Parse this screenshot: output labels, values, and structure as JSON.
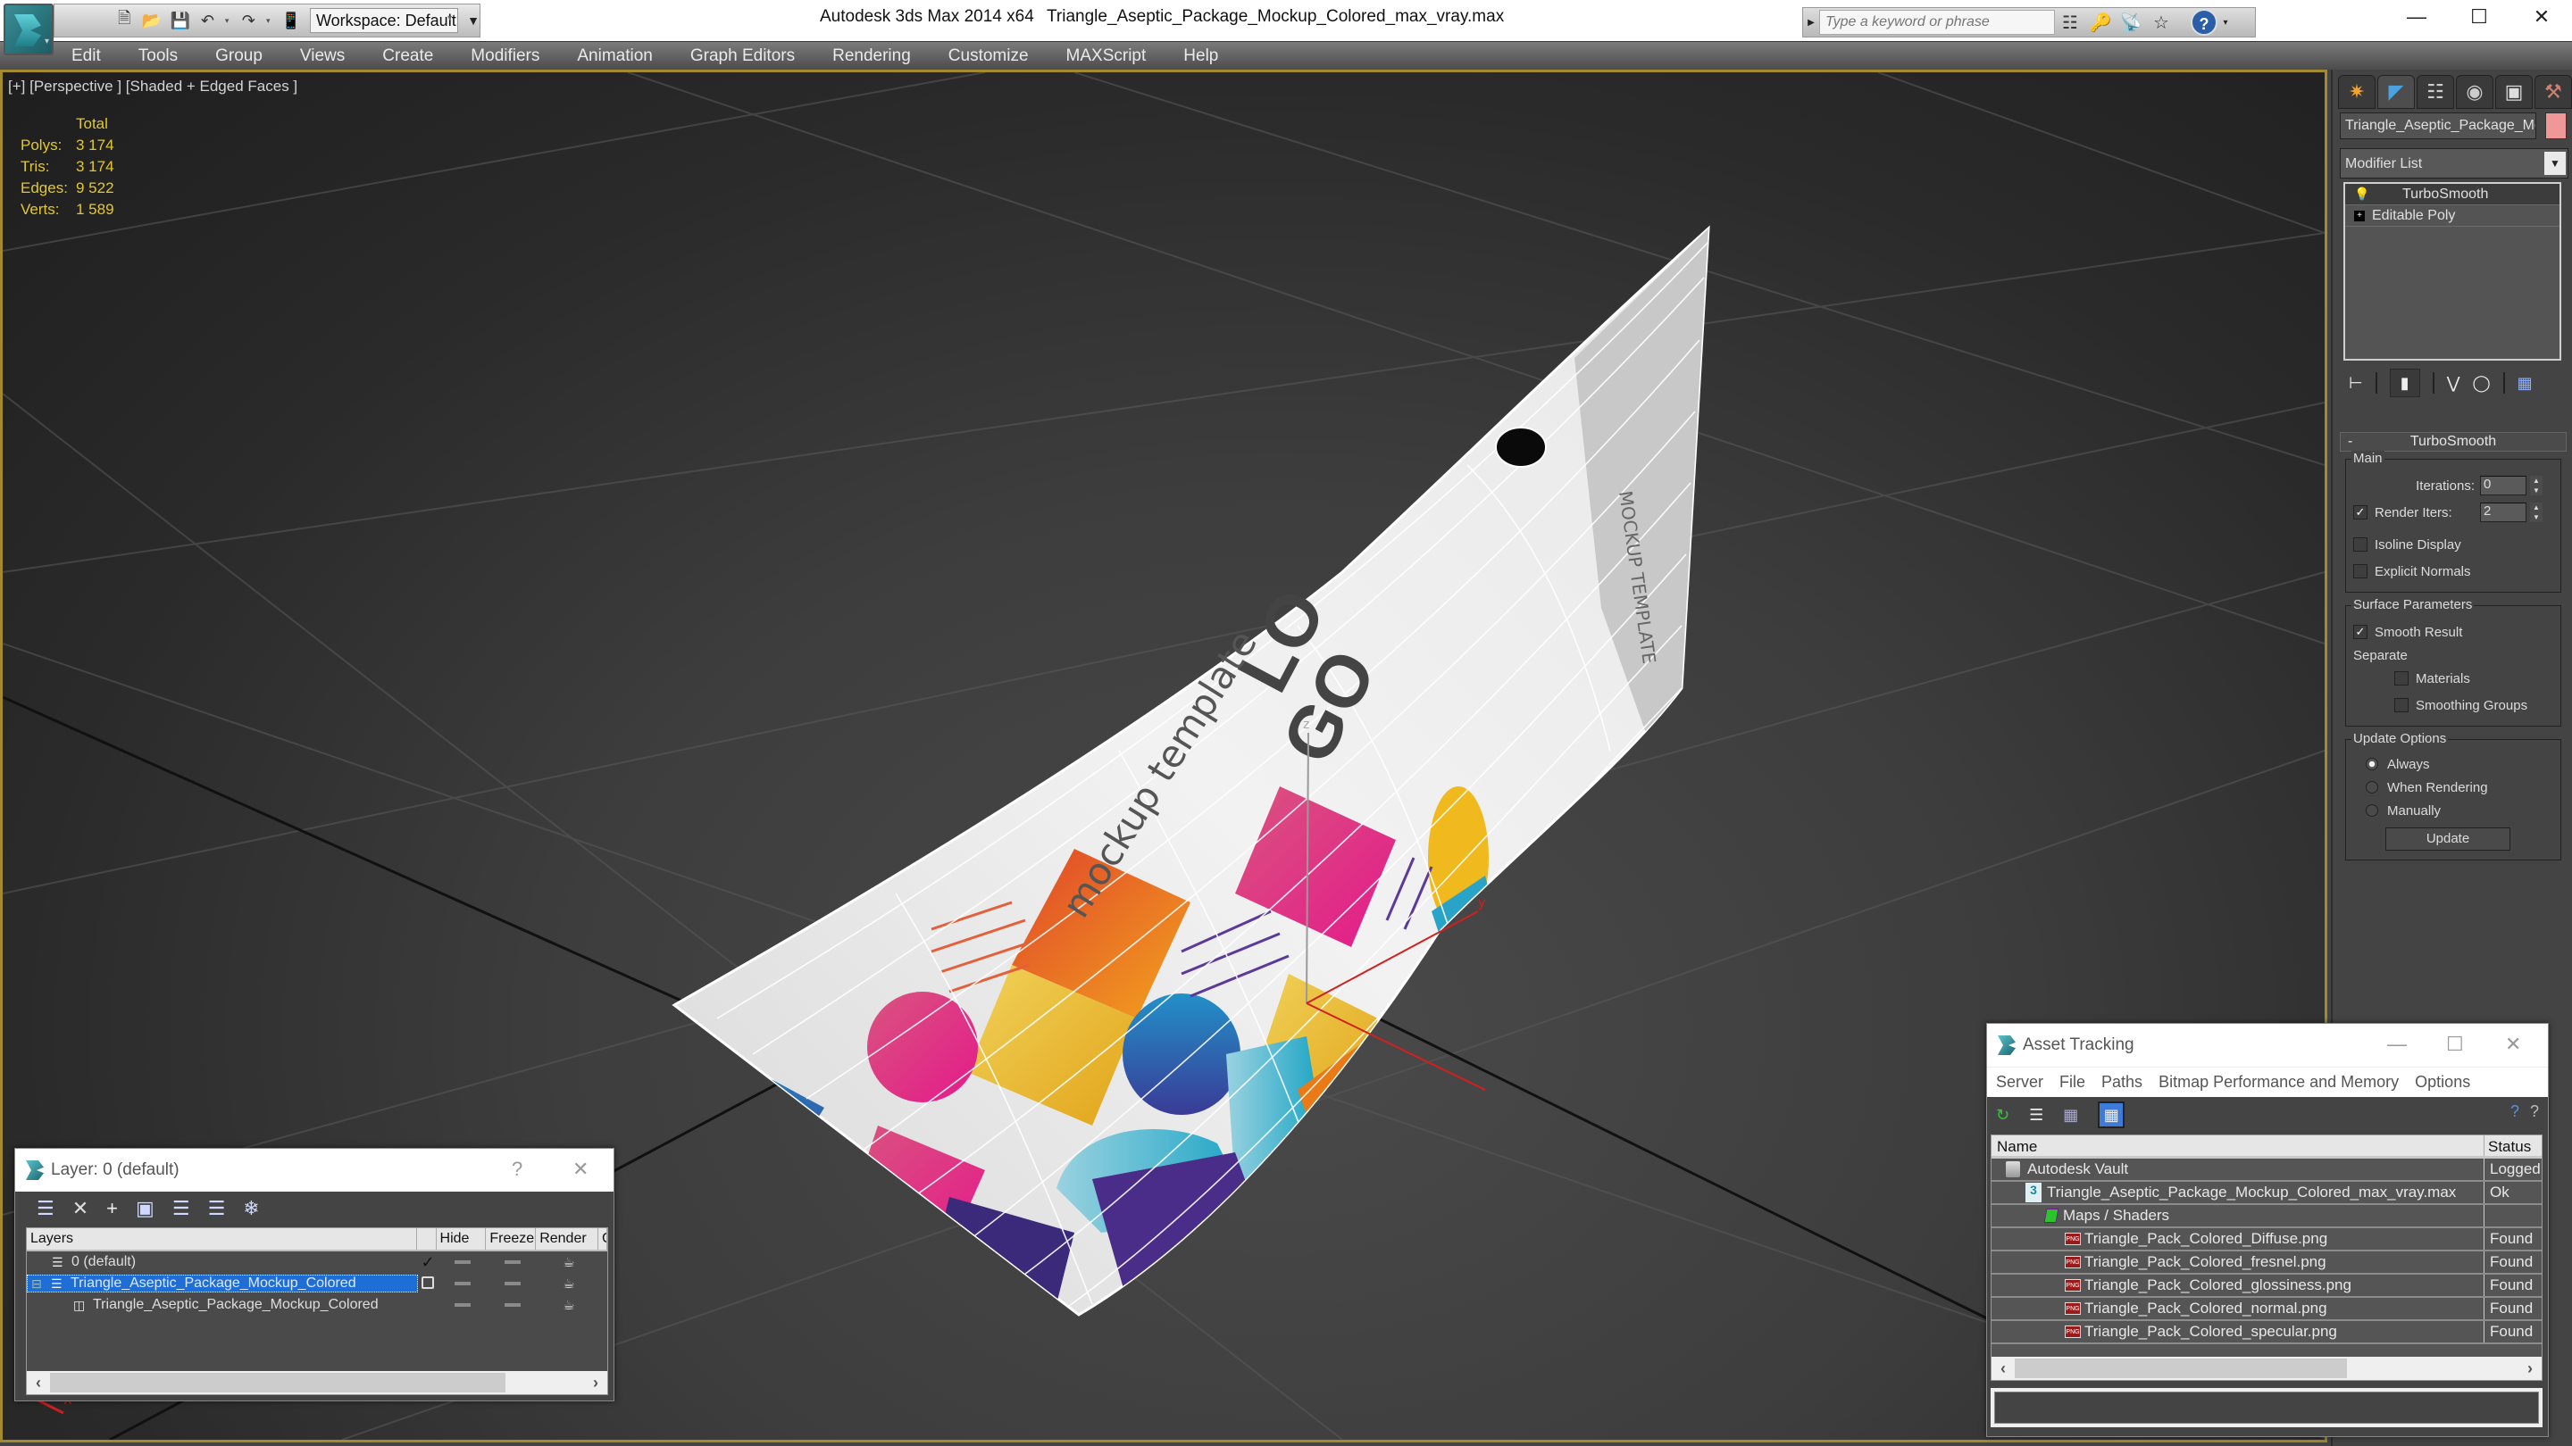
{
  "app": {
    "product": "Autodesk 3ds Max  2014 x64",
    "filename": "Triangle_Aseptic_Package_Mockup_Colored_max_vray.max",
    "workspace": "Workspace: Default",
    "search_placeholder": "Type a keyword or phrase",
    "window_controls": {
      "minimize": "—",
      "maximize": "☐",
      "close": "✕"
    }
  },
  "menu": [
    "Edit",
    "Tools",
    "Group",
    "Views",
    "Create",
    "Modifiers",
    "Animation",
    "Graph Editors",
    "Rendering",
    "Customize",
    "MAXScript",
    "Help"
  ],
  "viewport": {
    "label": "[+] [Perspective ] [Shaded + Edged Faces ]",
    "stats": {
      "header": "Total",
      "rows": [
        {
          "key": "Polys:",
          "value": "3 174"
        },
        {
          "key": "Tris:",
          "value": "3 174"
        },
        {
          "key": "Edges:",
          "value": "9 522"
        },
        {
          "key": "Verts:",
          "value": "1 589"
        }
      ]
    },
    "model_texture": {
      "logo_line1": "LO",
      "logo_line2": "GO",
      "tagline": "mockup template",
      "side_text": "MOCKUP TEMPLATE"
    },
    "gizmo_axes": {
      "x": "X",
      "y": "y",
      "z": "z"
    }
  },
  "command_panel": {
    "tabs": [
      "create",
      "modify",
      "hierarchy",
      "motion",
      "display",
      "utilities"
    ],
    "object_name": "Triangle_Aseptic_Package_Mockup_Colored",
    "object_color": "#f09898",
    "modifier_list_label": "Modifier List",
    "stack": [
      {
        "name": "TurboSmooth",
        "selected": true
      },
      {
        "name": "Editable Poly",
        "selected": false
      }
    ],
    "turbosmooth": {
      "title": "TurboSmooth",
      "main_label": "Main",
      "iterations_label": "Iterations:",
      "iterations_value": "0",
      "render_iters_label": "Render Iters:",
      "render_iters_value": "2",
      "render_iters_checked": true,
      "isoline_label": "Isoline Display",
      "isoline_checked": false,
      "explicit_normals_label": "Explicit Normals",
      "explicit_normals_checked": false,
      "surface_label": "Surface Parameters",
      "smooth_result_label": "Smooth Result",
      "smooth_result_checked": true,
      "separate_label": "Separate",
      "materials_label": "Materials",
      "smoothing_groups_label": "Smoothing Groups",
      "update_options_label": "Update Options",
      "update_options": [
        "Always",
        "When Rendering",
        "Manually"
      ],
      "update_selected": "Always",
      "update_button": "Update"
    }
  },
  "layer_dialog": {
    "title": "Layer: 0 (default)",
    "help": "?",
    "close": "✕",
    "columns": [
      "Layers",
      "",
      "Hide",
      "Freeze",
      "Render",
      "C"
    ],
    "rows": [
      {
        "name": "0 (default)",
        "current": true,
        "selected": false,
        "indent": 1,
        "type": "layer"
      },
      {
        "name": "Triangle_Aseptic_Package_Mockup_Colored",
        "current": false,
        "selected": true,
        "indent": 0,
        "type": "layer",
        "expanded": true
      },
      {
        "name": "Triangle_Aseptic_Package_Mockup_Colored",
        "current": false,
        "selected": false,
        "indent": 2,
        "type": "object"
      }
    ]
  },
  "asset_dialog": {
    "title": "Asset Tracking",
    "menu": [
      "Server",
      "File",
      "Paths",
      "Bitmap Performance and Memory",
      "Options"
    ],
    "columns": {
      "name": "Name",
      "status": "Status"
    },
    "rows": [
      {
        "name": "Autodesk Vault",
        "status": "Logged",
        "type": "vault",
        "indent": 0
      },
      {
        "name": "Triangle_Aseptic_Package_Mockup_Colored_max_vray.max",
        "status": "Ok",
        "type": "max",
        "indent": 1
      },
      {
        "name": "Maps / Shaders",
        "status": "",
        "type": "maps",
        "indent": 2
      },
      {
        "name": "Triangle_Pack_Colored_Diffuse.png",
        "status": "Found",
        "type": "png",
        "indent": 3
      },
      {
        "name": "Triangle_Pack_Colored_fresnel.png",
        "status": "Found",
        "type": "png",
        "indent": 3
      },
      {
        "name": "Triangle_Pack_Colored_glossiness.png",
        "status": "Found",
        "type": "png",
        "indent": 3
      },
      {
        "name": "Triangle_Pack_Colored_normal.png",
        "status": "Found",
        "type": "png",
        "indent": 3
      },
      {
        "name": "Triangle_Pack_Colored_specular.png",
        "status": "Found",
        "type": "png",
        "indent": 3
      }
    ]
  },
  "colors": {
    "viewport_border": "#a38a2f",
    "stats_text": "#e2c82e",
    "selection": "#1f6ed6"
  }
}
